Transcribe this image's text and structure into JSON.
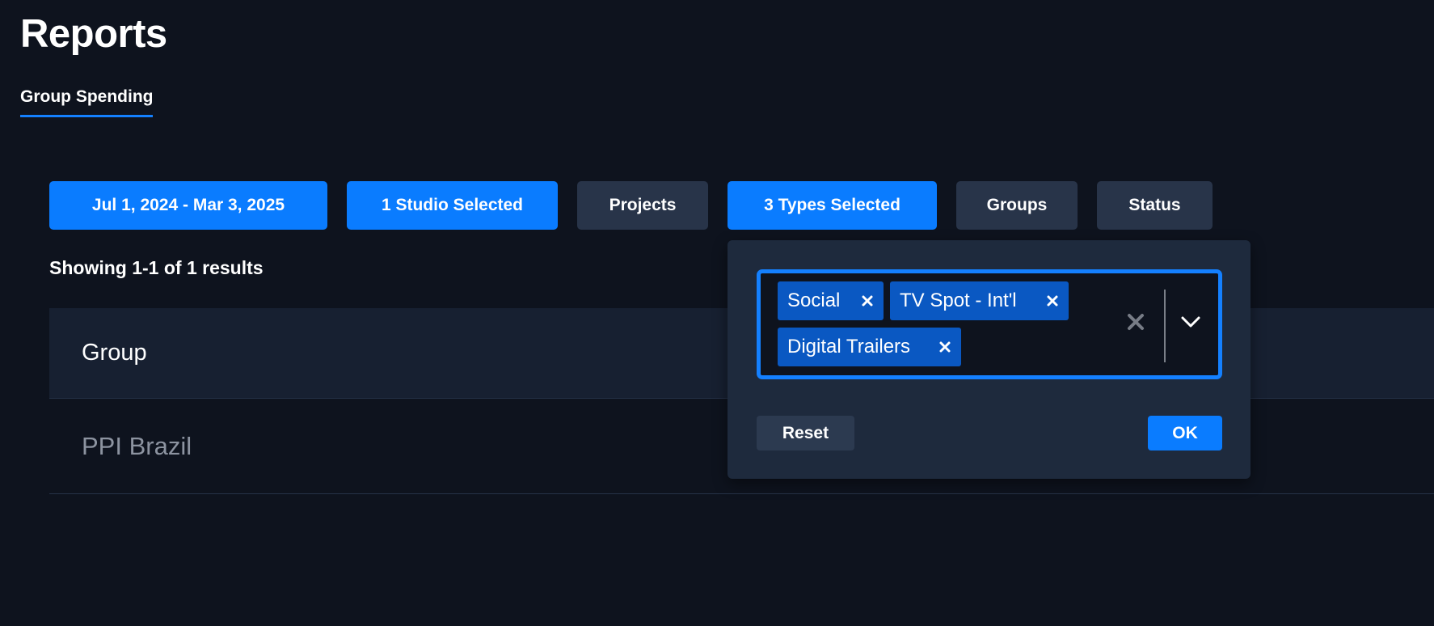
{
  "page": {
    "title": "Reports",
    "tab": "Group Spending"
  },
  "filters": [
    {
      "label": "Jul 1, 2024 - Mar 3, 2025",
      "active": true
    },
    {
      "label": "1 Studio Selected",
      "active": true
    },
    {
      "label": "Projects",
      "active": false
    },
    {
      "label": "3 Types Selected",
      "active": true
    },
    {
      "label": "Groups",
      "active": false
    },
    {
      "label": "Status",
      "active": false
    }
  ],
  "results": {
    "summary": "Showing 1-1 of 1 results"
  },
  "table": {
    "header": "Group",
    "rows": [
      "PPI Brazil"
    ]
  },
  "type_popover": {
    "selected": [
      "Social",
      "TV Spot - Int'l",
      "Digital Trailers"
    ],
    "reset_label": "Reset",
    "ok_label": "OK"
  },
  "colors": {
    "background": "#0e131e",
    "accent": "#0a7cff",
    "inactive_button": "#283449",
    "chip": "#0a58c2",
    "popover": "#1e2a3d"
  },
  "icons": {
    "chip_remove": "close-icon",
    "clear_all": "close-icon",
    "dropdown": "chevron-down-icon"
  }
}
